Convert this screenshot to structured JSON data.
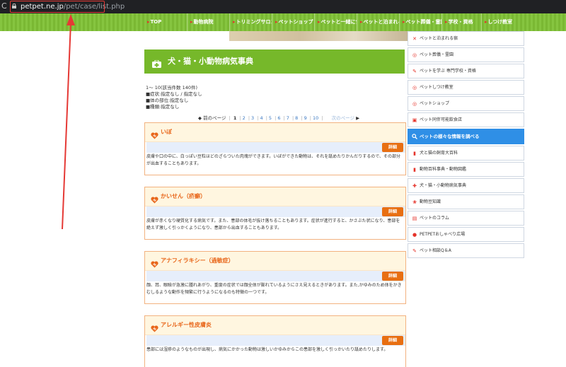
{
  "browser": {
    "url_host": "petpet.ne.jp",
    "url_path": "/pet/case/list.php"
  },
  "nav": {
    "items": [
      {
        "label": "TOP"
      },
      {
        "label": "動物病院"
      },
      {
        "label": "トリミングサロン"
      },
      {
        "label": "ペットショップ"
      },
      {
        "label": "ペットと一緒に食事"
      },
      {
        "label": "ペットと泊まれる宿"
      },
      {
        "label": "ペット葬儀・霊園"
      },
      {
        "label": "学校・資格"
      },
      {
        "label": "しつけ教室"
      }
    ]
  },
  "page": {
    "title": "犬・猫・小動物病気事典",
    "count_text": "1～ 10(該当件数 140件)",
    "filters": [
      "■症状:指定なし / 指定なし",
      "■体の部位:指定なし",
      "■種類:指定なし"
    ]
  },
  "pager": {
    "prev": "前のページ",
    "current": "1",
    "pages": [
      "2",
      "3",
      "4",
      "5",
      "6",
      "7",
      "8",
      "9",
      "10"
    ],
    "next": "次のページ"
  },
  "entries": [
    {
      "name": "いぼ",
      "button": "詳細",
      "description": "皮膚や口の中に、白っぽい豆粒ほどのざらついた肉塊ができます。いぼができた動物は、それを舐めたりかんだりするので、その部分が出血することもあります。"
    },
    {
      "name": "かいせん（疥癬）",
      "button": "詳細",
      "description": "皮膚が赤くなり硬質化する病気です。また、患部の体毛が抜け落ちることもあります。症状が進行すると、かさぶた状になり、患部を絶えず激しく引っかくようになり、患部から出血することもあります。"
    },
    {
      "name": "アナフィラキシー（過敏症）",
      "button": "詳細",
      "description": "顔、耳、眼瞼が急激に腫れあがり、重度の症状では顔全体が膨れているようにさえ見えるときがあります。また,かゆみのため体をかきむしるような動作を頻繁に行うようになるのも特徴の一つです。"
    },
    {
      "name": "アレルギー性皮膚炎",
      "button": "詳細",
      "description": "患部には湿疹のようなものが出現し、病気にかかった動物は激しいかゆみからこの患部を激しく引っかいたり舐めたりします。"
    }
  ],
  "sidebar": {
    "items": [
      {
        "label": "ペットと泊まれる宿",
        "icon": "x-icon"
      },
      {
        "label": "ペット葬儀・霊園",
        "icon": "circle-icon"
      },
      {
        "label": "ペットを学ぶ 専門学校・資格",
        "icon": "pencil-icon"
      },
      {
        "label": "ペットしつけ教室",
        "icon": "circle-icon"
      },
      {
        "label": "ペットショップ",
        "icon": "circle-icon"
      },
      {
        "label": "ペット同伴可能飲食店",
        "icon": "square-icon"
      }
    ],
    "search_label": "ペットの様々な情報を調べる",
    "items2": [
      {
        "label": "犬と猫の飼育大百科",
        "icon": "book-icon"
      },
      {
        "label": "動物百科事典・動物図鑑",
        "icon": "book-icon"
      },
      {
        "label": "犬・猫・小動物病気事典",
        "icon": "medkit-icon"
      },
      {
        "label": "動物豆知識",
        "icon": "paw-icon"
      },
      {
        "label": "ペットのコラム",
        "icon": "grid-icon"
      },
      {
        "label": "PETPETおしゃべり広場",
        "icon": "chat-icon"
      },
      {
        "label": "ペット相談Q＆A",
        "icon": "pencil-icon"
      }
    ]
  },
  "colors": {
    "nav_green": "#86c540",
    "title_green": "#76b82a",
    "entry_orange": "#e8661a",
    "search_blue": "#2f8fe6",
    "annotation_red": "#e53935"
  }
}
